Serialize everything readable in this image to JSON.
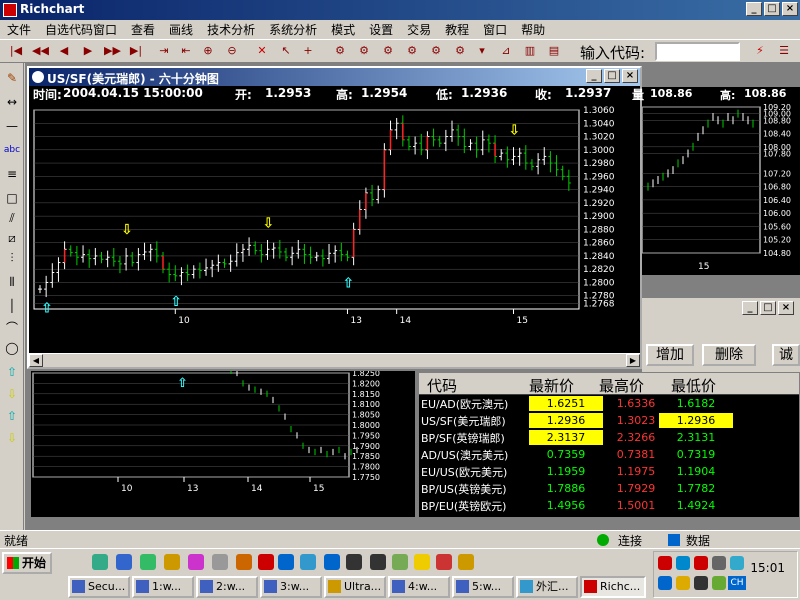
{
  "app": {
    "title": "Richchart",
    "menu": [
      "文件",
      "自选代码窗口",
      "查看",
      "画线",
      "技术分析",
      "系统分析",
      "模式",
      "设置",
      "交易",
      "教程",
      "窗口",
      "帮助"
    ],
    "code_label": "输入代码:",
    "code_value": ""
  },
  "window_buttons": {
    "minimize": "_",
    "maximize": "□",
    "close": "×"
  },
  "main_chart": {
    "title": "US/SF(美元瑞郎) - 六十分钟图",
    "info": {
      "time_label": "时间:",
      "time": "2004.04.15 15:00:00",
      "open_label": "开:",
      "open": "1.2953",
      "high_label": "高:",
      "high": "1.2954",
      "low_label": "低:",
      "low": "1.2936",
      "close_label": "收:",
      "close": "1.2937",
      "amount_label": "量",
      "amount": "108.86"
    }
  },
  "side_chart": {
    "high_label": "高:",
    "amount": "108.86",
    "high": "108.86"
  },
  "quote_panel": {
    "add_button": "增加",
    "delete_button": "删除",
    "third_button": "诚",
    "headers": [
      "代码",
      "最新价",
      "最高价",
      "最低价"
    ],
    "rows": [
      {
        "code": "EU/AD(欧元澳元)",
        "last": "1.6251",
        "high": "1.6336",
        "low": "1.6182"
      },
      {
        "code": "US/SF(美元瑞郎)",
        "last": "1.2936",
        "high": "1.3023",
        "low": "1.2936"
      },
      {
        "code": "BP/SF(英镑瑞郎)",
        "last": "2.3137",
        "high": "2.3266",
        "low": "2.3131"
      },
      {
        "code": "AD/US(澳元美元)",
        "last": "0.7359",
        "high": "0.7381",
        "low": "0.7319"
      },
      {
        "code": "EU/US(欧元美元)",
        "last": "1.1959",
        "high": "1.1975",
        "low": "1.1904"
      },
      {
        "code": "BP/US(英镑美元)",
        "last": "1.7886",
        "high": "1.7929",
        "low": "1.7782"
      },
      {
        "code": "BP/EU(英镑欧元)",
        "last": "1.4956",
        "high": "1.5001",
        "low": "1.4924"
      }
    ]
  },
  "status": {
    "left": "就绪",
    "connect": "连接",
    "data": "数据"
  },
  "taskbar": {
    "start": "开始",
    "buttons": [
      "Secu...",
      "1:w...",
      "2:w...",
      "3:w...",
      "Ultra...",
      "4:w...",
      "5:w...",
      "外汇...",
      "Richc..."
    ],
    "clock": "15:01",
    "lang": "CH"
  },
  "chart_data": [
    {
      "type": "candlestick",
      "name": "US/SF 60min",
      "ylim": [
        1.276,
        1.306
      ],
      "y_ticks": [
        "1.3060",
        "1.3040",
        "1.3020",
        "1.3000",
        "1.2980",
        "1.2960",
        "1.2940",
        "1.2920",
        "1.2900",
        "1.2880",
        "1.2860",
        "1.2840",
        "1.2820",
        "1.2800",
        "1.2780",
        "1.2768"
      ],
      "x_labels": [
        "10",
        "13",
        "14",
        "15"
      ],
      "close_path": [
        1.279,
        1.28,
        1.2815,
        1.283,
        1.285,
        1.2845,
        1.2838,
        1.2842,
        1.2836,
        1.284,
        1.2835,
        1.2838,
        1.2832,
        1.2828,
        1.284,
        1.283,
        1.2842,
        1.2846,
        1.285,
        1.284,
        1.282,
        1.2812,
        1.281,
        1.2815,
        1.2812,
        1.282,
        1.2818,
        1.2822,
        1.2826,
        1.283,
        1.2828,
        1.2832,
        1.2845,
        1.285,
        1.2856,
        1.2848,
        1.2842,
        1.285,
        1.2852,
        1.2846,
        1.2838,
        1.2844,
        1.285,
        1.2842,
        1.2838,
        1.284,
        1.2836,
        1.2844,
        1.2848,
        1.2842,
        1.2838,
        1.288,
        1.291,
        1.2935,
        1.2925,
        1.294,
        1.3,
        1.303,
        1.304,
        1.3015,
        1.3005,
        1.301,
        1.3,
        1.302,
        1.3015,
        1.301,
        1.302,
        1.303,
        1.302,
        1.3005,
        1.301,
        1.3,
        1.3015,
        1.301,
        1.299,
        1.2995,
        1.2985,
        1.299,
        1.2995,
        1.298,
        1.2975,
        1.2985,
        1.299,
        1.298,
        1.297,
        1.296,
        1.295
      ],
      "down_arrows": [
        14,
        37,
        77
      ],
      "up_arrows": [
        1,
        22,
        50
      ]
    },
    {
      "type": "candlestick",
      "name": "side chart",
      "y_ticks": [
        "109.20",
        "109.00",
        "108.80",
        "108.40",
        "108.00",
        "107.80",
        "107.20",
        "106.80",
        "106.40",
        "106.00",
        "105.60",
        "105.20",
        "104.80"
      ],
      "x_labels": [
        "15"
      ]
    },
    {
      "type": "candlestick",
      "name": "lower chart",
      "y_ticks": [
        "1.8250",
        "1.8200",
        "1.8150",
        "1.8100",
        "1.8050",
        "1.8000",
        "1.7950",
        "1.7900",
        "1.7850",
        "1.7800",
        "1.7750"
      ],
      "x_labels": [
        "10",
        "13",
        "14",
        "15"
      ]
    }
  ]
}
